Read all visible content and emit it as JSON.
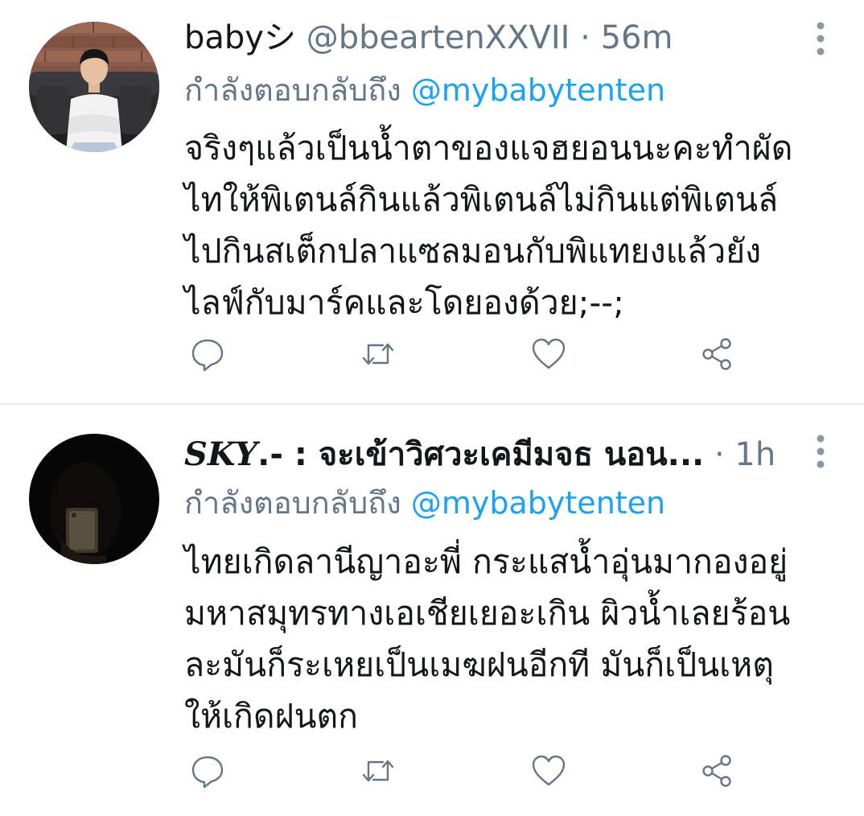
{
  "tweets": [
    {
      "display_name": "babyシ",
      "handle": "@bbeartenXXVII",
      "separator": "·",
      "time": "56m",
      "replying_prefix": "กำลังตอบกลับถึง",
      "replying_to": "@mybabytenten",
      "body_lines": [
        "จริงๆแล้วเป็นน้ำตาของแจฮยอนนะคะทำผัด",
        "ไทให้พิเตนล์กินแล้วพิเตนล์ไม่กินแต่พิเตนล์",
        "ไปกินสเต็กปลาแซลมอนกับพิแทยงแล้วยัง",
        "ไลฟ์กับมาร์คและโดยองด้วย;--;"
      ]
    },
    {
      "display_name_styled": "SKY",
      "display_name_rest": ".- : จะเข้าวิศวะเคมีมจธ นอน...",
      "separator": "·",
      "time": "1h",
      "replying_prefix": "กำลังตอบกลับถึง",
      "replying_to": "@mybabytenten",
      "body_lines": [
        "ไทยเกิดลานีญาอะพี่ กระแสน้ำอุ่นมากองอยู่",
        "มหาสมุทรทางเอเชียเยอะเกิน ผิวน้ำเลยร้อน",
        "ละมันก็ระเหยเป็นเมฆฝนอีกที มันก็เป็นเหตุ",
        "ให้เกิดฝนตก"
      ]
    }
  ],
  "icons": {
    "more": "more-vertical-icon",
    "reply": "reply-icon",
    "retweet": "retweet-icon",
    "like": "heart-icon",
    "share": "share-icon"
  },
  "colors": {
    "text": "#14171a",
    "secondary": "#657786",
    "link": "#1da1f2",
    "divider": "#e1e8ed"
  }
}
